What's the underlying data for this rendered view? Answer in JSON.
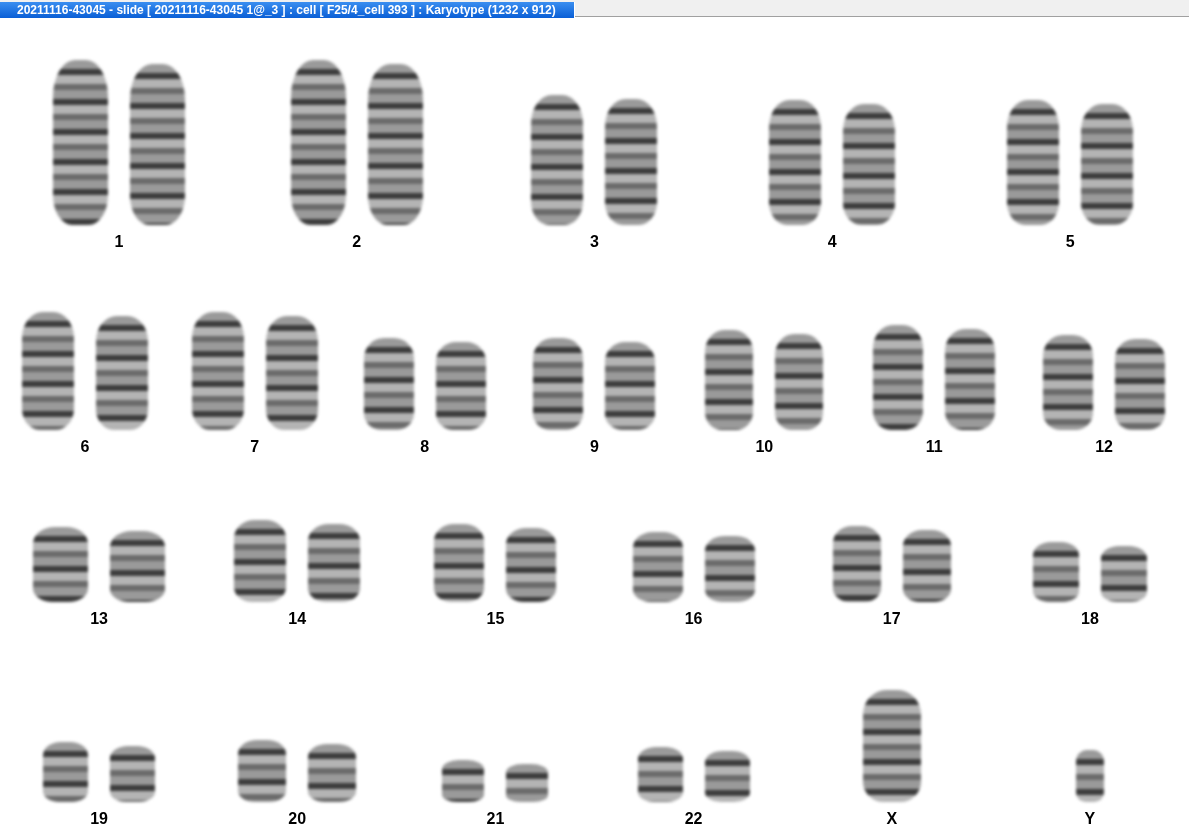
{
  "window": {
    "title": "20211116-43045 - slide [ 20211116-43045 1@_3 ] : cell [ F25/4_cell 393 ] : Karyotype  (1232 x 912)"
  },
  "karyotype": {
    "rows": [
      {
        "groups": [
          {
            "label": "1",
            "kind": "pair"
          },
          {
            "label": "2",
            "kind": "pair"
          },
          {
            "label": "3",
            "kind": "pair"
          },
          {
            "label": "4",
            "kind": "pair"
          },
          {
            "label": "5",
            "kind": "pair"
          }
        ]
      },
      {
        "groups": [
          {
            "label": "6",
            "kind": "pair"
          },
          {
            "label": "7",
            "kind": "pair"
          },
          {
            "label": "8",
            "kind": "pair"
          },
          {
            "label": "9",
            "kind": "pair"
          },
          {
            "label": "10",
            "kind": "pair"
          },
          {
            "label": "11",
            "kind": "pair"
          },
          {
            "label": "12",
            "kind": "pair"
          }
        ]
      },
      {
        "groups": [
          {
            "label": "13",
            "kind": "pair"
          },
          {
            "label": "14",
            "kind": "pair"
          },
          {
            "label": "15",
            "kind": "pair"
          },
          {
            "label": "16",
            "kind": "pair"
          },
          {
            "label": "17",
            "kind": "pair"
          },
          {
            "label": "18",
            "kind": "pair"
          }
        ]
      },
      {
        "groups": [
          {
            "label": "19",
            "kind": "pair"
          },
          {
            "label": "20",
            "kind": "pair"
          },
          {
            "label": "21",
            "kind": "pair"
          },
          {
            "label": "22",
            "kind": "pair"
          },
          {
            "label": "X",
            "kind": "single"
          },
          {
            "label": "Y",
            "kind": "single"
          }
        ]
      }
    ]
  }
}
